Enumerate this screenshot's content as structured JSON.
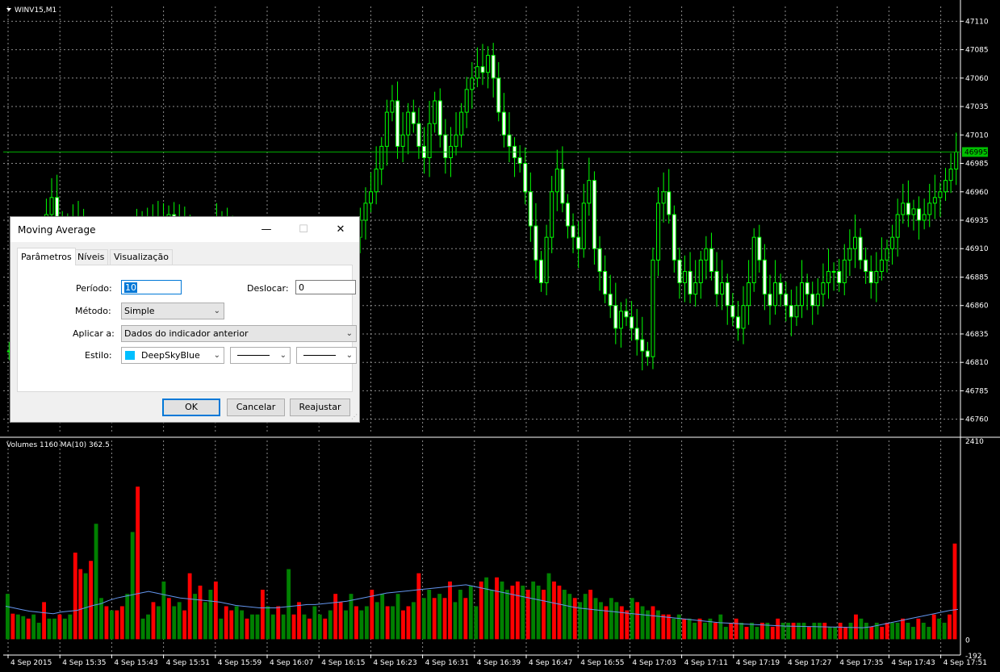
{
  "chart": {
    "symbol_label": "WINV15,M1",
    "volumes_label": "Volumes 1160 MA(10) 362.5",
    "current_price": "46995",
    "price_ticks": [
      "47110",
      "47085",
      "47060",
      "47035",
      "47010",
      "46985",
      "46960",
      "46935",
      "46910",
      "46885",
      "46860",
      "46835",
      "46810",
      "46785",
      "46760"
    ],
    "volume_ticks": [
      "2410",
      "0",
      "-192"
    ],
    "time_labels": [
      "4 Sep 2015",
      "4 Sep 15:35",
      "4 Sep 15:43",
      "4 Sep 15:51",
      "4 Sep 15:59",
      "4 Sep 16:07",
      "4 Sep 16:15",
      "4 Sep 16:23",
      "4 Sep 16:31",
      "4 Sep 16:39",
      "4 Sep 16:47",
      "4 Sep 16:55",
      "4 Sep 17:03",
      "4 Sep 17:11",
      "4 Sep 17:19",
      "4 Sep 17:27",
      "4 Sep 17:35",
      "4 Sep 17:43",
      "4 Sep 17:51"
    ],
    "colors": {
      "background": "#000000",
      "grid": "#8c8c8c",
      "bull": "#00ff00",
      "bear": "#00ff00",
      "volume_up": "#008000",
      "volume_down": "#ff0000",
      "ma_line": "#6495ed",
      "price_line": "#00b000",
      "badge": "#00c000"
    }
  },
  "chart_data": [
    {
      "type": "candlestick",
      "title": "WINV15,M1",
      "ylim": [
        46740,
        47125
      ],
      "current_price": 46995,
      "x_labels": [
        "4 Sep 2015",
        "4 Sep 15:35",
        "4 Sep 15:43",
        "4 Sep 15:51",
        "4 Sep 15:59",
        "4 Sep 16:07",
        "4 Sep 16:15",
        "4 Sep 16:23",
        "4 Sep 16:31",
        "4 Sep 16:39",
        "4 Sep 16:47",
        "4 Sep 16:55",
        "4 Sep 17:03",
        "4 Sep 17:11",
        "4 Sep 17:19",
        "4 Sep 17:27",
        "4 Sep 17:35",
        "4 Sep 17:43",
        "4 Sep 17:51"
      ],
      "close": [
        46820,
        46840,
        46850,
        46870,
        46880,
        46900,
        46920,
        46940,
        46955,
        46935,
        46930,
        46920,
        46935,
        46925,
        46915,
        46920,
        46910,
        46915,
        46905,
        46895,
        46900,
        46910,
        46905,
        46920,
        46925,
        46935,
        46930,
        46935,
        46925,
        46930,
        46940,
        46935,
        46930,
        46920,
        46910,
        46905,
        46900,
        46905,
        46915,
        46930,
        46935,
        46925,
        46915,
        46910,
        46905,
        46900,
        46910,
        46905,
        46900,
        46895,
        46900,
        46905,
        46910,
        46915,
        46910,
        46905,
        46900,
        46895,
        46890,
        46895,
        46900,
        46905,
        46900,
        46895,
        46910,
        46920,
        46935,
        46950,
        46960,
        46980,
        47000,
        47030,
        47040,
        47000,
        47010,
        47030,
        47020,
        47000,
        46990,
        47020,
        47040,
        47010,
        46990,
        47000,
        47010,
        47030,
        47050,
        47060,
        47070,
        47065,
        47080,
        47060,
        47030,
        47010,
        47000,
        46990,
        46985,
        46960,
        46930,
        46900,
        46880,
        46920,
        46960,
        46980,
        46950,
        46930,
        46920,
        46910,
        46950,
        46970,
        46910,
        46890,
        46870,
        46860,
        46840,
        46855,
        46850,
        46840,
        46830,
        46820,
        46815,
        46900,
        46950,
        46960,
        46940,
        46900,
        46880,
        46890,
        46870,
        46880,
        46900,
        46910,
        46890,
        46870,
        46880,
        46860,
        46850,
        46840,
        46860,
        46880,
        46920,
        46900,
        46870,
        46860,
        46880,
        46870,
        46860,
        46850,
        46860,
        46880,
        46870,
        46860,
        46870,
        46880,
        46890,
        46890,
        46880,
        46900,
        46910,
        46920,
        46900,
        46890,
        46880,
        46890,
        46900,
        46910,
        46920,
        46940,
        46950,
        46940,
        46945,
        46935,
        46940,
        46950,
        46955,
        46960,
        46970,
        46980,
        46995
      ]
    },
    {
      "type": "bar",
      "title": "Volumes 1160 MA(10) 362.5",
      "ylim": [
        -192,
        2410
      ],
      "series": [
        {
          "name": "Volumes",
          "values": [
            550,
            310,
            300,
            280,
            250,
            300,
            200,
            450,
            250,
            250,
            300,
            250,
            300,
            1050,
            850,
            800,
            950,
            1400,
            500,
            400,
            350,
            350,
            400,
            550,
            1300,
            1850,
            250,
            300,
            450,
            400,
            700,
            500,
            400,
            450,
            350,
            800,
            550,
            650,
            450,
            600,
            700,
            250,
            400,
            350,
            400,
            350,
            250,
            300,
            300,
            600,
            400,
            300,
            400,
            300,
            850,
            300,
            450,
            300,
            250,
            400,
            300,
            250,
            350,
            550,
            450,
            350,
            550,
            400,
            350,
            400,
            600,
            450,
            550,
            400,
            400,
            550,
            350,
            400,
            450,
            800,
            500,
            600,
            500,
            550,
            500,
            700,
            450,
            600,
            500,
            650,
            400,
            700,
            750,
            600,
            750,
            700,
            600,
            650,
            700,
            650,
            600,
            700,
            650,
            600,
            800,
            700,
            650,
            600,
            550,
            500,
            450,
            550,
            600,
            500,
            450,
            400,
            500,
            450,
            400,
            350,
            500,
            450,
            400,
            350,
            400,
            350,
            300,
            300,
            250,
            300,
            250,
            250,
            200,
            250,
            200,
            250,
            200,
            300,
            150,
            200,
            250,
            200,
            150,
            200,
            150,
            200,
            200,
            150,
            250,
            200,
            200,
            200,
            200,
            200,
            150,
            200,
            200,
            200,
            150,
            150,
            200,
            150,
            200,
            300,
            250,
            200,
            150,
            200,
            150,
            200,
            200,
            200,
            250,
            200,
            150,
            250,
            200,
            150,
            300,
            250,
            200,
            300,
            1160
          ]
        },
        {
          "name": "MA(10)",
          "values": [
            400,
            380,
            360,
            340,
            330,
            320,
            310,
            330,
            340,
            350,
            380,
            410,
            430,
            470,
            500,
            520,
            540,
            560,
            580,
            560,
            540,
            520,
            500,
            490,
            480,
            470,
            460,
            450,
            430,
            410,
            400,
            390,
            380,
            380,
            380,
            390,
            400,
            410,
            420,
            420,
            430,
            440,
            450,
            460,
            480,
            500,
            520,
            540,
            560,
            570,
            580,
            590,
            600,
            610,
            620,
            630,
            640,
            650,
            660,
            640,
            620,
            600,
            580,
            560,
            540,
            520,
            500,
            480,
            460,
            440,
            420,
            400,
            380,
            370,
            360,
            350,
            340,
            330,
            320,
            310,
            300,
            290,
            280,
            270,
            260,
            250,
            240,
            230,
            220,
            210,
            200,
            195,
            190,
            185,
            180,
            175,
            170,
            165,
            160,
            158,
            156,
            154,
            152,
            150,
            148,
            146,
            144,
            142,
            140,
            150,
            170,
            190,
            210,
            230,
            250,
            270,
            290,
            310,
            330,
            350,
            362
          ]
        }
      ]
    }
  ],
  "dialog": {
    "title": "Moving Average",
    "minimize": "—",
    "maximize": "☐",
    "close": "✕",
    "tabs": [
      "Parâmetros",
      "Níveis",
      "Visualização"
    ],
    "period_label": "Período:",
    "period_value": "10",
    "shift_label": "Deslocar:",
    "shift_value": "0",
    "method_label": "Método:",
    "method_value": "Simple",
    "apply_label": "Aplicar a:",
    "apply_value": "Dados do indicador anterior",
    "style_label": "Estilo:",
    "style_color_name": "DeepSkyBlue",
    "style_color": "#00bfff",
    "ok": "OK",
    "cancel": "Cancelar",
    "reset": "Reajustar"
  }
}
